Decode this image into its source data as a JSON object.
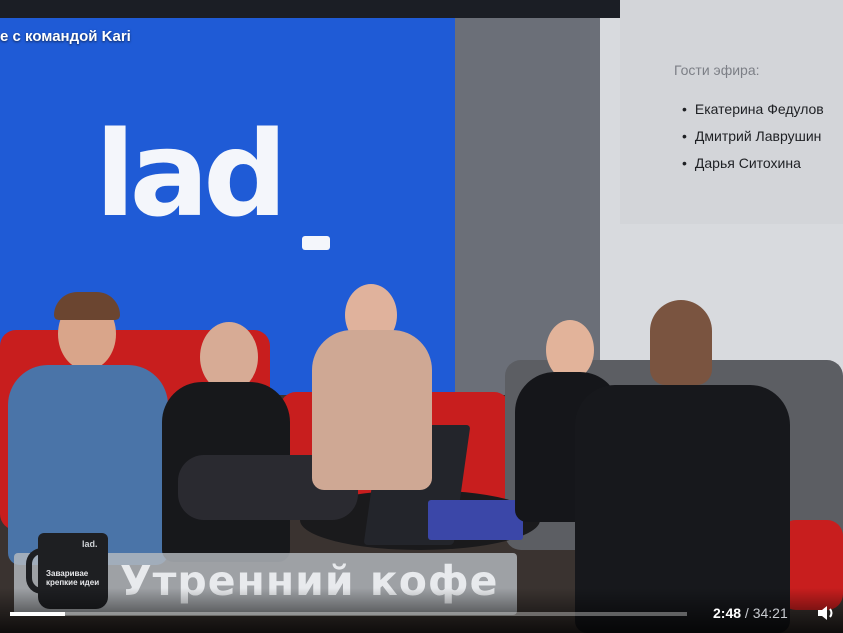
{
  "video": {
    "title": "е с командой Kari",
    "current_time": "2:48",
    "separator": "/",
    "total_time": "34:21",
    "progress": 0.0815
  },
  "scene": {
    "logo_text": "lad"
  },
  "guests": {
    "heading": "Гости эфира:",
    "names": [
      "Екатерина Федулов",
      "Дмитрий Лаврушин",
      "Дарья Ситохина"
    ]
  },
  "lower_third": {
    "title": "Утренний кофе",
    "mug_logo": "lad.",
    "mug_text": "Заваривае крепкие идеи"
  },
  "colors": {
    "wall_blue": "#1f5bd6",
    "sofa_red": "#c81e1e",
    "panel_bg": "#d3d5d9"
  },
  "icons": {
    "volume": "volume-icon"
  }
}
